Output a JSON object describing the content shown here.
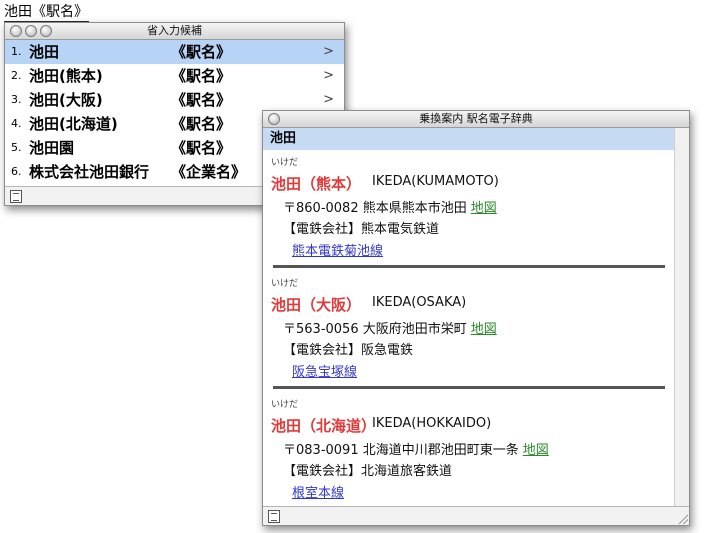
{
  "composing": "池田《駅名》",
  "candidates": {
    "title": "省入力候補",
    "items": [
      {
        "num": "1.",
        "word": "池田",
        "cat": "《駅名》",
        "arrow": ">"
      },
      {
        "num": "2.",
        "word": "池田(熊本)",
        "cat": "《駅名》",
        "arrow": ">"
      },
      {
        "num": "3.",
        "word": "池田(大阪)",
        "cat": "《駅名》",
        "arrow": ">"
      },
      {
        "num": "4.",
        "word": "池田(北海道)",
        "cat": "《駅名》",
        "arrow": ""
      },
      {
        "num": "5.",
        "word": "池田園",
        "cat": "《駅名》",
        "arrow": ""
      },
      {
        "num": "6.",
        "word": "株式会社池田銀行",
        "cat": "《企業名》",
        "arrow": ""
      }
    ]
  },
  "dictionary": {
    "title": "乗換案内 駅名電子辞典",
    "headword": "池田",
    "entries": [
      {
        "reading": "いけだ",
        "name": "池田（熊本）",
        "roman": "IKEDA(KUMAMOTO)",
        "address": "〒860-0082 熊本県熊本市池田",
        "map": "地図",
        "company": "【電鉄会社】熊本電気鉄道",
        "line": "熊本電鉄菊池線"
      },
      {
        "reading": "いけだ",
        "name": "池田（大阪）",
        "roman": "IKEDA(OSAKA)",
        "address": "〒563-0056 大阪府池田市栄町",
        "map": "地図",
        "company": "【電鉄会社】阪急電鉄",
        "line": "阪急宝塚線"
      },
      {
        "reading": "いけだ",
        "name": "池田（北海道）",
        "roman": "IKEDA(HOKKAIDO)",
        "address": "〒083-0091 北海道中川郡池田町東一条",
        "map": "地図",
        "company": "【電鉄会社】北海道旅客鉄道",
        "line": "根室本線"
      }
    ]
  },
  "colors": {
    "selection": "#b7d4f7",
    "headword_bg": "#c5daf3",
    "station_name": "#e03a3a",
    "map_link": "#2a8a2a",
    "line_link": "#3338cc"
  },
  "icons": [
    "window-close-icon",
    "window-minimize-icon",
    "window-zoom-icon",
    "document-icon",
    "resize-grip-icon"
  ]
}
